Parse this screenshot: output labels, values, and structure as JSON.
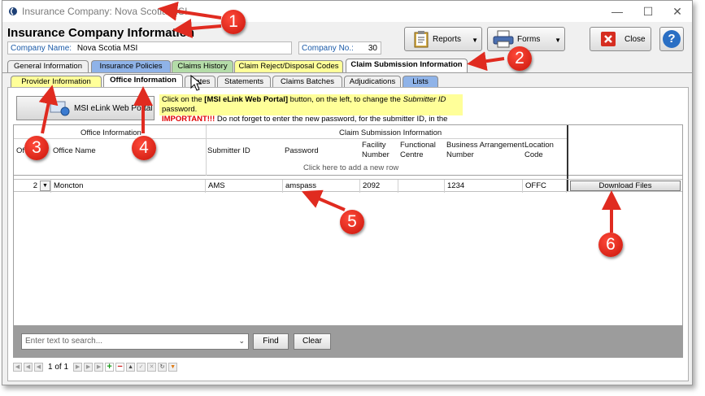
{
  "window": {
    "title": "Insurance Company:  Nova Scotia MSI"
  },
  "header": {
    "heading": "Insurance Company Information",
    "company_name_label": "Company Name:",
    "company_name_value": "Nova Scotia MSI",
    "company_no_label": "Company No.:",
    "company_no_value": "30"
  },
  "toolbar": {
    "reports_label": "Reports",
    "forms_label": "Forms",
    "close_label": "Close",
    "help_label": "?"
  },
  "main_tabs": [
    {
      "label": "General Information",
      "color": "#f0f0f0"
    },
    {
      "label": "Insurance Policies",
      "color": "#8fb3e8"
    },
    {
      "label": "Claims History",
      "color": "#b4dca8"
    },
    {
      "label": "Claim Reject/Disposal Codes",
      "color": "#ffff99"
    },
    {
      "label": "Claim Submission Information",
      "color": "#ffffff"
    }
  ],
  "sub_tabs": [
    {
      "label": "Provider Information",
      "color": "#ffff99"
    },
    {
      "label": "Office Information",
      "color": "#ffffff"
    },
    {
      "label": "Rates",
      "color": "#f0f0f0"
    },
    {
      "label": "Statements",
      "color": "#f0f0f0"
    },
    {
      "label": "Claims Batches",
      "color": "#f0f0f0"
    },
    {
      "label": "Adjudications",
      "color": "#f0f0f0"
    },
    {
      "label": "Lists",
      "color": "#8fb3e8"
    }
  ],
  "portal": {
    "button_label": "MSI eLink Web Portal",
    "notice_line1_a": "Click on the ",
    "notice_line1_b": "[MSI eLink Web Portal]",
    "notice_line1_c": " button, on the left, to change the ",
    "notice_line1_d": "Submitter ID",
    "notice_line1_e": " password.",
    "notice_line2_a": "IMPORTANT!!!",
    "notice_line2_b": " Do not forget to enter the new password, for the submitter ID, in the grid below."
  },
  "grid": {
    "group_office": "Office Information",
    "group_claim": "Claim Submission Information",
    "col_office_no": "Of",
    "col_office_name": "Office Name",
    "col_submitter_id": "Submitter ID",
    "col_password": "Password",
    "col_facility_1": "Facility",
    "col_facility_2": "Number",
    "col_functional_1": "Functional",
    "col_functional_2": "Centre",
    "col_business_1": "Business Arrangement",
    "col_business_2": "Number",
    "col_location_1": "Location",
    "col_location_2": "Code",
    "add_row_hint": "Click here to add a new row",
    "row": {
      "office_no": "2",
      "office_name": "Moncton",
      "submitter_id": "AMS",
      "password": "amspass",
      "facility_number": "2092",
      "functional_centre": "",
      "business_arrangement": "1234",
      "location_code": "OFFC",
      "download_label": "Download Files"
    }
  },
  "search": {
    "placeholder": "Enter text to search...",
    "find_label": "Find",
    "clear_label": "Clear"
  },
  "pager": {
    "page_text": "1 of 1"
  },
  "callouts": [
    "1",
    "2",
    "3",
    "4",
    "5",
    "6"
  ]
}
